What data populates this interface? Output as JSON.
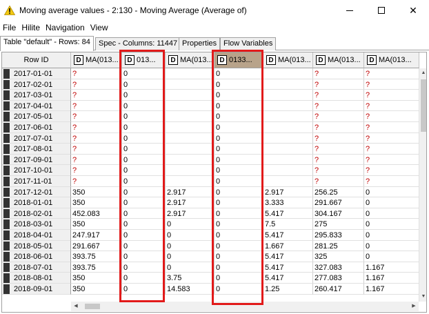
{
  "window": {
    "title": "Moving average values - 2:130 - Moving Average (Average of)",
    "minimize_glyph": "",
    "maximize_glyph": "",
    "close_glyph": "✕"
  },
  "menu": [
    "File",
    "Hilite",
    "Navigation",
    "View"
  ],
  "tabs": [
    {
      "label": "Table \"default\" - Rows: 84",
      "active": true
    },
    {
      "label": "Spec - Columns: 11447",
      "active": false
    },
    {
      "label": "Properties",
      "active": false
    },
    {
      "label": "Flow Variables",
      "active": false
    }
  ],
  "table": {
    "type_badge": "D",
    "columns": [
      {
        "label": "Row ID",
        "badge": false
      },
      {
        "label": "MA(013...",
        "badge": true
      },
      {
        "label": "013...",
        "badge": true
      },
      {
        "label": "MA(013...",
        "badge": true
      },
      {
        "label": "0133...",
        "badge": true,
        "selected": true
      },
      {
        "label": "MA(013...",
        "badge": true
      },
      {
        "label": "MA(013...",
        "badge": true
      },
      {
        "label": "MA(013...",
        "badge": true
      }
    ],
    "rows": [
      [
        "2017-01-01",
        "?",
        "0",
        "",
        "0",
        "",
        "?",
        "?"
      ],
      [
        "2017-02-01",
        "?",
        "0",
        "",
        "0",
        "",
        "?",
        "?"
      ],
      [
        "2017-03-01",
        "?",
        "0",
        "",
        "0",
        "",
        "?",
        "?"
      ],
      [
        "2017-04-01",
        "?",
        "0",
        "",
        "0",
        "",
        "?",
        "?"
      ],
      [
        "2017-05-01",
        "?",
        "0",
        "",
        "0",
        "",
        "?",
        "?"
      ],
      [
        "2017-06-01",
        "?",
        "0",
        "",
        "0",
        "",
        "?",
        "?"
      ],
      [
        "2017-07-01",
        "?",
        "0",
        "",
        "0",
        "",
        "?",
        "?"
      ],
      [
        "2017-08-01",
        "?",
        "0",
        "",
        "0",
        "",
        "?",
        "?"
      ],
      [
        "2017-09-01",
        "?",
        "0",
        "",
        "0",
        "",
        "?",
        "?"
      ],
      [
        "2017-10-01",
        "?",
        "0",
        "",
        "0",
        "",
        "?",
        "?"
      ],
      [
        "2017-11-01",
        "?",
        "0",
        "",
        "0",
        "",
        "?",
        "?"
      ],
      [
        "2017-12-01",
        "350",
        "0",
        "2.917",
        "0",
        "2.917",
        "256.25",
        "0"
      ],
      [
        "2018-01-01",
        "350",
        "0",
        "2.917",
        "0",
        "3.333",
        "291.667",
        "0"
      ],
      [
        "2018-02-01",
        "452.083",
        "0",
        "2.917",
        "0",
        "5.417",
        "304.167",
        "0"
      ],
      [
        "2018-03-01",
        "350",
        "0",
        "0",
        "0",
        "7.5",
        "275",
        "0"
      ],
      [
        "2018-04-01",
        "247.917",
        "0",
        "0",
        "0",
        "5.417",
        "295.833",
        "0"
      ],
      [
        "2018-05-01",
        "291.667",
        "0",
        "0",
        "0",
        "1.667",
        "281.25",
        "0"
      ],
      [
        "2018-06-01",
        "393.75",
        "0",
        "0",
        "0",
        "5.417",
        "325",
        "0"
      ],
      [
        "2018-07-01",
        "393.75",
        "0",
        "0",
        "0",
        "5.417",
        "327.083",
        "1.167"
      ],
      [
        "2018-08-01",
        "350",
        "0",
        "3.75",
        "0",
        "5.417",
        "277.083",
        "1.167"
      ],
      [
        "2018-09-01",
        "350",
        "0",
        "14.583",
        "0",
        "1.25",
        "260.417",
        "1.167"
      ]
    ]
  },
  "scroll": {
    "up": "▲",
    "down": "▼",
    "left": "◀",
    "right": "▶"
  },
  "colors": {
    "highlight": "#e21a1a",
    "selected_header": "#b8a38a",
    "missing_value": "#c00000",
    "warning_icon": "#f2c811"
  }
}
